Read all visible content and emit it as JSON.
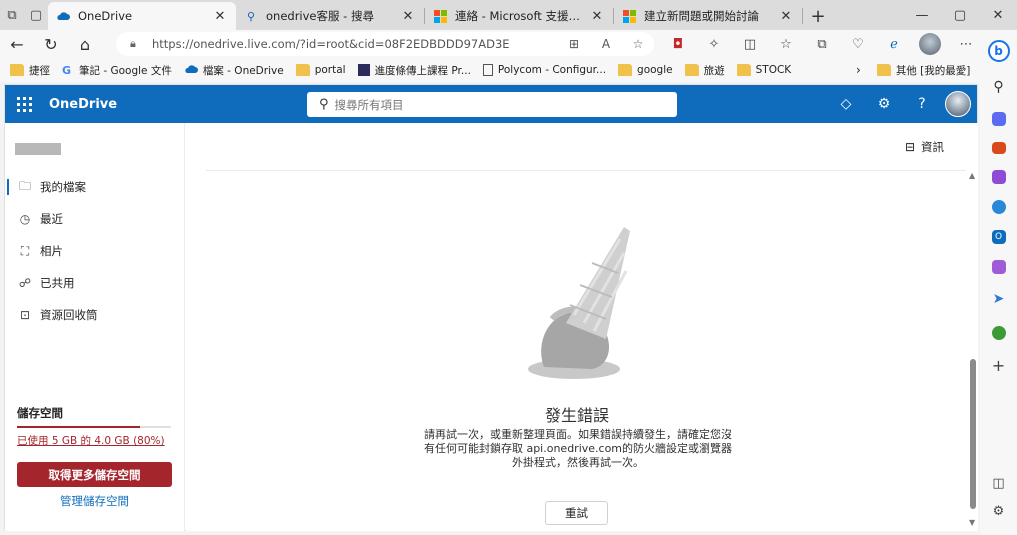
{
  "browser": {
    "tabs": [
      {
        "title": "OneDrive",
        "icon": "cloud-icon",
        "active": true
      },
      {
        "title": "onedrive客服 - 搜尋",
        "icon": "search-icon",
        "active": false
      },
      {
        "title": "連絡 - Microsoft 支援服務",
        "icon": "microsoft-logo-icon",
        "active": false
      },
      {
        "title": "建立新問題或開始討論",
        "icon": "microsoft-logo-icon",
        "active": false
      }
    ],
    "url": "https://onedrive.live.com/?id=root&cid=08F2EDBDDD97AD3E",
    "bookmarks": [
      {
        "label": "捷徑",
        "icon": "folder-icon"
      },
      {
        "label": "筆記 - Google 文件",
        "icon": "google-icon"
      },
      {
        "label": "檔案 - OneDrive",
        "icon": "cloud-icon"
      },
      {
        "label": "portal",
        "icon": "folder-icon"
      },
      {
        "label": "進度條傳上課程 Pr...",
        "icon": "app-icon"
      },
      {
        "label": "Polycom - Configur...",
        "icon": "page-icon"
      },
      {
        "label": "google",
        "icon": "folder-icon"
      },
      {
        "label": "旅遊",
        "icon": "folder-icon"
      },
      {
        "label": "STOCK",
        "icon": "folder-icon"
      }
    ],
    "other_bookmarks": "其他 [我的最愛]"
  },
  "header": {
    "brand": "OneDrive",
    "search_placeholder": "搜尋所有項目"
  },
  "sidebar": {
    "items": [
      {
        "label": "我的檔案",
        "icon": "folder-icon",
        "selected": true
      },
      {
        "label": "最近",
        "icon": "history-icon",
        "selected": false
      },
      {
        "label": "相片",
        "icon": "photo-icon",
        "selected": false
      },
      {
        "label": "已共用",
        "icon": "people-icon",
        "selected": false
      },
      {
        "label": "資源回收筒",
        "icon": "recycle-bin-icon",
        "selected": false
      }
    ],
    "storage": {
      "title": "儲存空間",
      "usage_text": "已使用 5 GB 的 4.0 GB (80%)",
      "fraction": 0.8,
      "get_more_label": "取得更多儲存空間",
      "manage_label": "管理儲存空間"
    }
  },
  "main": {
    "info_label": "資訊",
    "error_title": "發生錯誤",
    "error_message": "請再試一次，或重新整理頁面。如果錯誤持續發生，請確定您沒有任何可能封鎖存取 api.onedrive.com的防火牆設定或瀏覽器外掛程式，然後再試一次。",
    "retry_label": "重試"
  },
  "colors": {
    "brand_blue": "#0f6cbd",
    "storage_red": "#a4262c"
  }
}
